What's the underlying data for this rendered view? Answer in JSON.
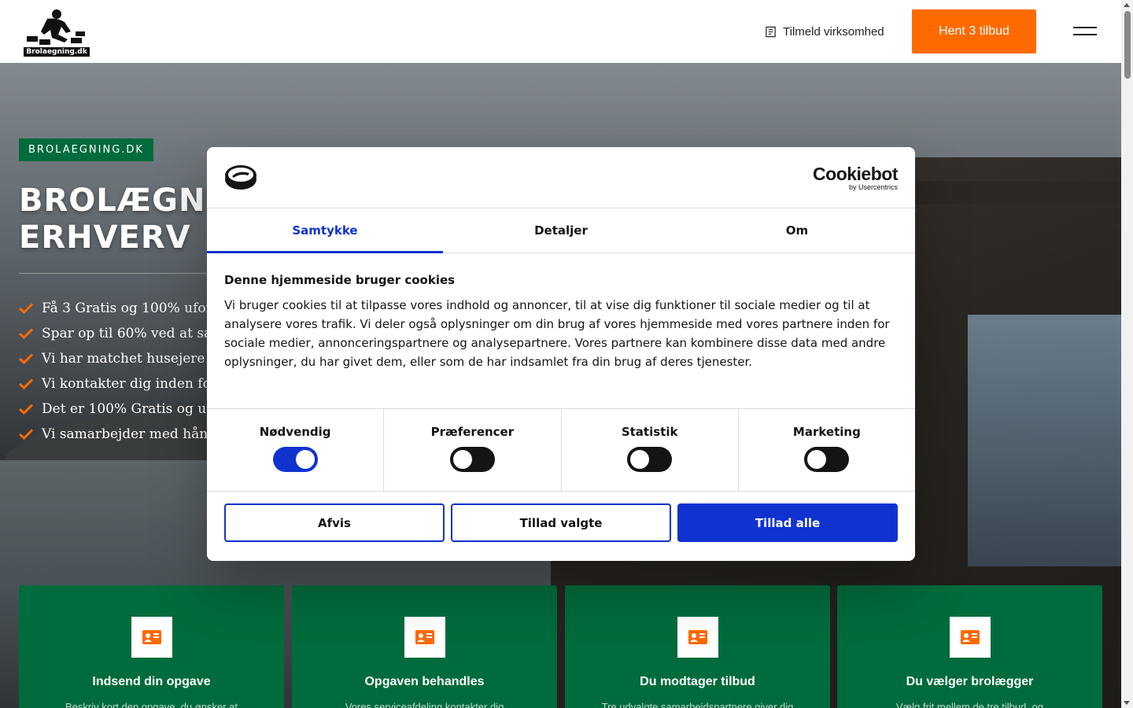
{
  "header": {
    "logo_text": "Brolaegning.dk",
    "signup_label": "Tilmeld virksomhed",
    "cta_label": "Hent 3 tilbud",
    "accent_color": "#ff6a00"
  },
  "hero": {
    "badge": "BROLAEGNING.DK",
    "title_line1": "BROLÆGNING",
    "title_line2": "ERHVERV",
    "bullets": [
      "Få 3 Gratis og 100% uforpligtende tilbud",
      "Spar op til 60% ved at sammenligne",
      "Vi har matchet husejere og brolæggere",
      "Vi kontakter dig inden for 24 timer",
      "Det er 100% Gratis og uforpligtende",
      "Vi samarbejder med håndværkere"
    ]
  },
  "steps": [
    {
      "title": "Indsend din opgave",
      "desc": "Beskriv kort den opgave, du ønsker at"
    },
    {
      "title": "Opgaven behandles",
      "desc": "Vores serviceafdeling kontakter dig"
    },
    {
      "title": "Du modtager tilbud",
      "desc": "Tre udvalgte samarbejdspartnere giver dig"
    },
    {
      "title": "Du vælger brolægger",
      "desc": "Vælg frit mellem de tre tilbud, og"
    }
  ],
  "cookie_dialog": {
    "brand": "Cookiebot",
    "brand_sub": "by Usercentrics",
    "tabs": [
      "Samtykke",
      "Detaljer",
      "Om"
    ],
    "heading": "Denne hjemmeside bruger cookies",
    "body": "Vi bruger cookies til at tilpasse vores indhold og annoncer, til at vise dig funktioner til sociale medier og til at analysere vores trafik. Vi deler også oplysninger om din brug af vores hjemmeside med vores partnere inden for sociale medier, annonceringspartnere og analysepartnere. Vores partnere kan kombinere disse data med andre oplysninger, du har givet dem, eller som de har indsamlet fra din brug af deres tjenester.",
    "toggles": [
      {
        "label": "Nødvendig",
        "state": "on"
      },
      {
        "label": "Præferencer",
        "state": "off"
      },
      {
        "label": "Statistik",
        "state": "off"
      },
      {
        "label": "Marketing",
        "state": "off"
      }
    ],
    "buttons": {
      "reject": "Afvis",
      "allow_selected": "Tillad valgte",
      "allow_all": "Tillad alle"
    },
    "primary_color": "#1032cf"
  },
  "colors": {
    "green": "#006b3c",
    "orange": "#ff6a00",
    "blue": "#1032cf"
  }
}
